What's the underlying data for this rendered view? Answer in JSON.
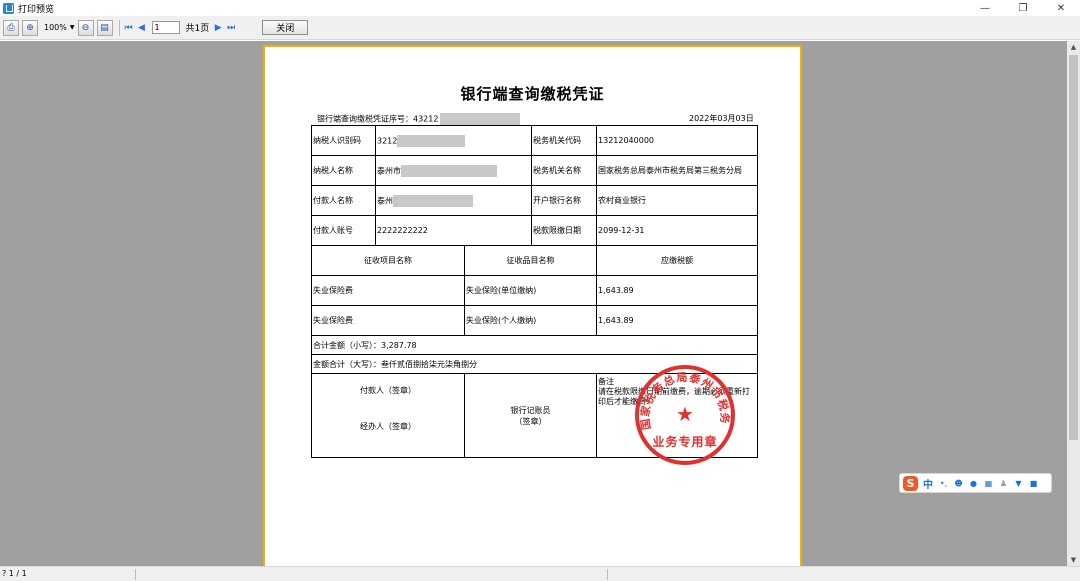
{
  "window": {
    "title": "打印预览",
    "controls": [
      "—",
      "❐",
      "✕"
    ]
  },
  "toolbar": {
    "zoom_value": "100%",
    "page_input": "1",
    "total_pages_label": "共1页",
    "close_label": "关闭"
  },
  "document": {
    "title": "银行端查询缴税凭证",
    "serial_label": "银行端查询缴税凭证序号：",
    "serial_prefix": "43212",
    "date": "2022年03月03日",
    "rows": [
      {
        "label1": "纳税人识别码",
        "value1_prefix": "3212",
        "label2": "税务机关代码",
        "value2": "13212040000"
      },
      {
        "label1": "纳税人名称",
        "value1_prefix": "泰州市",
        "label2": "税务机关名称",
        "value2": "国家税务总局泰州市税务局第三税务分局"
      },
      {
        "label1": "付款人名称",
        "value1_prefix": "泰州",
        "label2": "开户银行名称",
        "value2": "农村商业银行"
      },
      {
        "label1": "付款人账号",
        "value1_prefix": "2222222222",
        "label2": "税款限缴日期",
        "value2": "2099-12-31"
      }
    ],
    "items_header": {
      "col1": "征收项目名称",
      "col2": "征收品目名称",
      "col3": "应缴税额"
    },
    "items": [
      {
        "project": "失业保险费",
        "item": "失业保险(单位缴纳)",
        "amount": "1,643.89"
      },
      {
        "project": "失业保险费",
        "item": "失业保险(个人缴纳)",
        "amount": "1,643.89"
      }
    ],
    "total_small": "合计金额（小写）：3,287.78",
    "total_big": "金额合计（大写）：叁仟贰佰捌拾柒元柒角捌分",
    "sign": {
      "payer": "付款人（签章）",
      "handler": "经办人（签章）",
      "bank_clerk": "银行记账员",
      "bank_clerk_sign": "（签章）",
      "remark_label": "备注",
      "remark_text": "请在税款限缴日期前缴费，逾期必须重新打印后才能缴费!"
    },
    "stamp": {
      "ring_text": "国家税务总局泰州市税务局",
      "bottom_text": "业务专用章"
    }
  },
  "statusbar": {
    "page_info": "? 1 / 1"
  },
  "ime": {
    "logo": "S",
    "mode": "中",
    "icons": [
      "comma-icon",
      "emoji-icon",
      "mic-icon",
      "keyboard-icon",
      "user-icon",
      "shirt-icon",
      "grid-icon"
    ]
  }
}
